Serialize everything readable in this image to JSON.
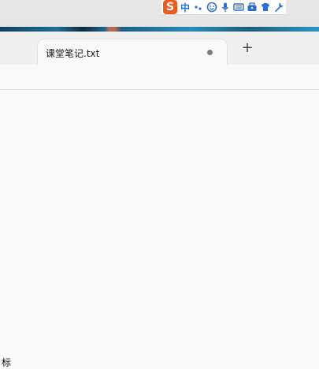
{
  "ime": {
    "logo_letter": "S",
    "mode_label": "中",
    "icons": [
      "punctuation-icon",
      "emoji-icon",
      "microphone-icon",
      "keyboard-icon",
      "toolbox-icon",
      "skin-icon",
      "settings-wrench-icon"
    ]
  },
  "tabs": {
    "active_title": "课堂笔记.txt",
    "new_tab_label": "+"
  },
  "editor": {
    "partial_bottom_text": "标"
  }
}
